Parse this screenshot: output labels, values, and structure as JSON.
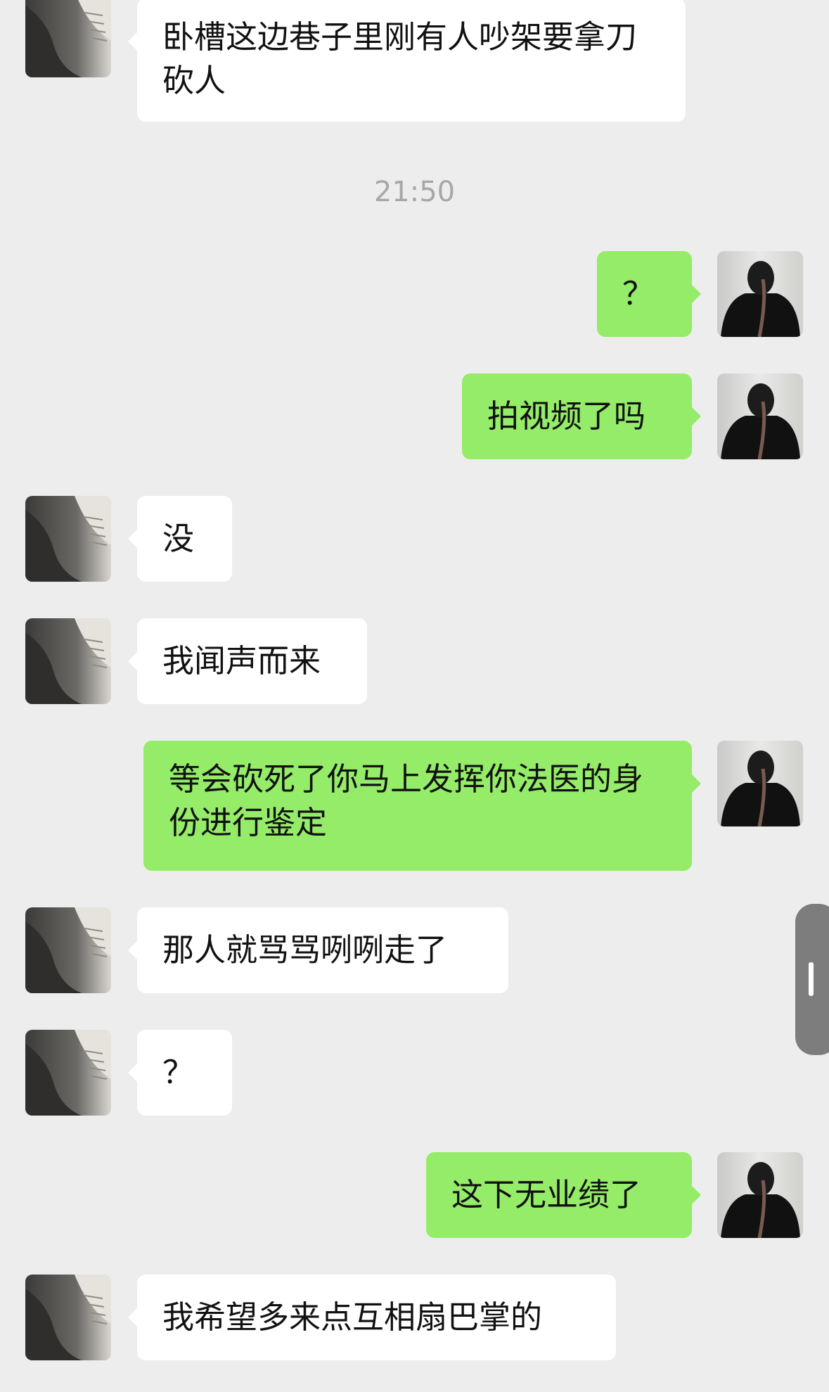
{
  "chat": {
    "timestamp": "21:50",
    "messages": [
      {
        "from": "other",
        "text": "卧槽这边巷子里刚有人吵架要拿刀砍人"
      },
      {
        "from": "self",
        "text": "？"
      },
      {
        "from": "self",
        "text": "拍视频了吗"
      },
      {
        "from": "other",
        "text": "没"
      },
      {
        "from": "other",
        "text": "我闻声而来"
      },
      {
        "from": "self",
        "text": "等会砍死了你马上发挥你法医的身份进行鉴定"
      },
      {
        "from": "other",
        "text": "那人就骂骂咧咧走了"
      },
      {
        "from": "other",
        "text": "？"
      },
      {
        "from": "self",
        "text": "这下无业绩了"
      },
      {
        "from": "other",
        "text": "我希望多来点互相扇巴掌的"
      }
    ]
  },
  "avatars": {
    "other": {
      "icon": "cat-photo-avatar"
    },
    "self": {
      "icon": "person-back-photo-avatar"
    }
  },
  "colors": {
    "background": "#ededed",
    "incoming_bubble": "#ffffff",
    "outgoing_bubble": "#95ec69",
    "timestamp_text": "#a7a7a7"
  }
}
